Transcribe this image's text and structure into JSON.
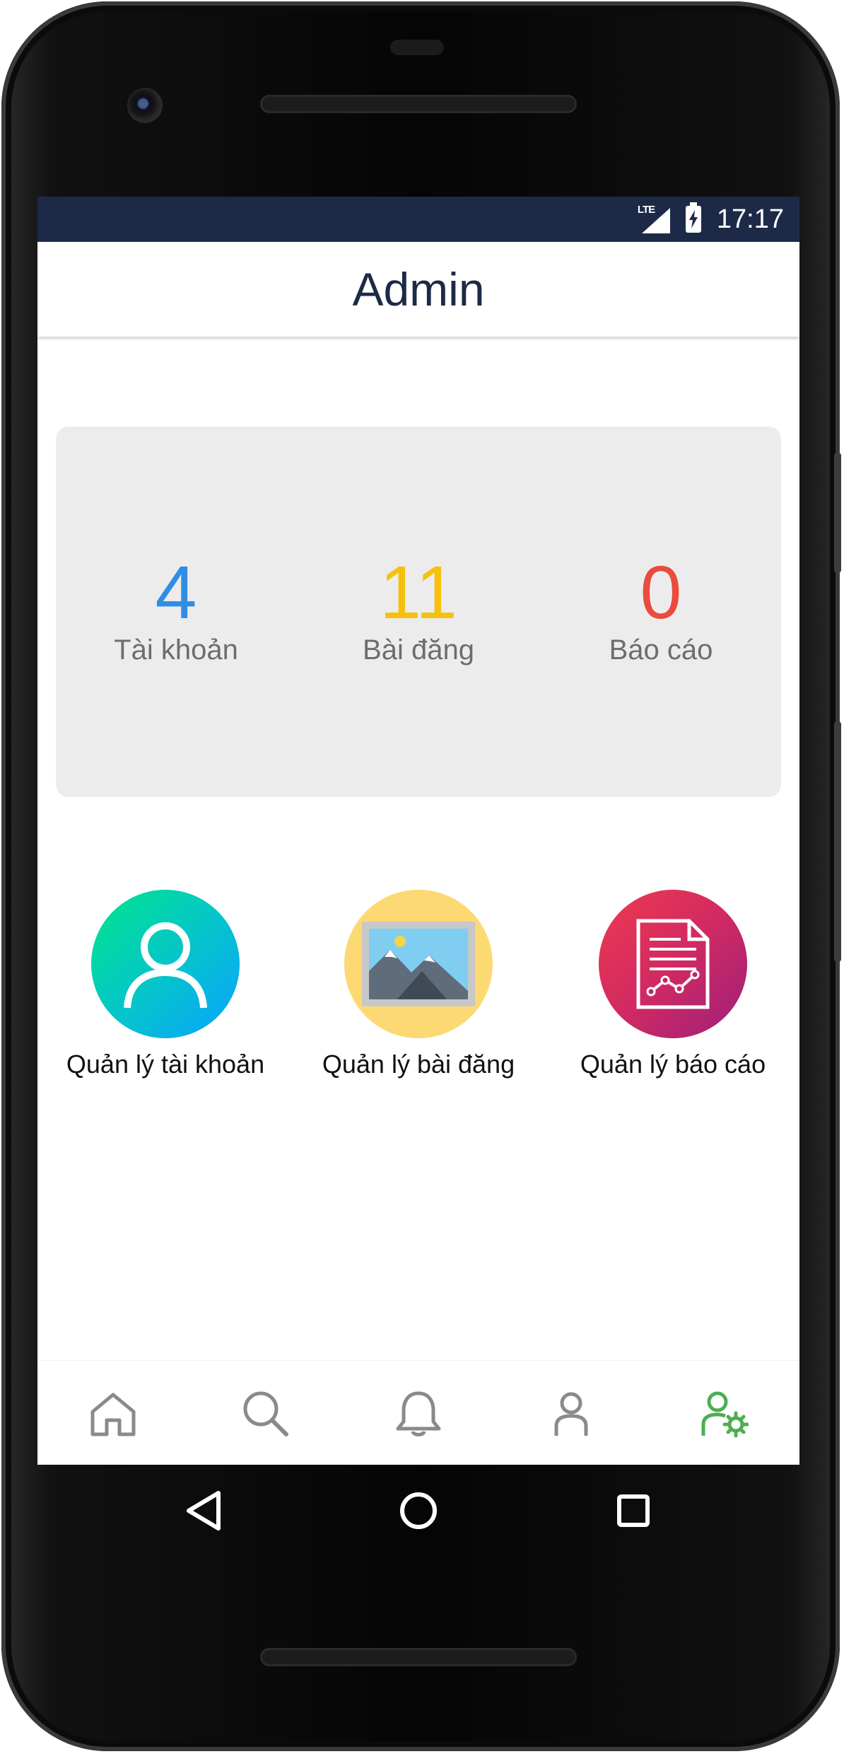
{
  "status_bar": {
    "network": "LTE",
    "time": "17:17"
  },
  "app_bar": {
    "title": "Admin"
  },
  "stats": [
    {
      "value": "4",
      "label": "Tài khoản",
      "color": "#2f8de4"
    },
    {
      "value": "11",
      "label": "Bài đăng",
      "color": "#f6c10d"
    },
    {
      "value": "0",
      "label": "Báo cáo",
      "color": "#e94b3c"
    }
  ],
  "actions": [
    {
      "label": "Quản lý tài khoản",
      "icon": "user-icon"
    },
    {
      "label": "Quản lý bài đăng",
      "icon": "image-icon"
    },
    {
      "label": "Quản lý báo cáo",
      "icon": "report-document-icon"
    }
  ],
  "bottom_nav": {
    "items": [
      "home-icon",
      "search-icon",
      "bell-icon",
      "profile-icon",
      "admin-settings-icon"
    ],
    "active": "admin-settings-icon",
    "active_color": "#4caf50",
    "inactive_color": "#8a8a8a"
  },
  "system_nav": [
    "back-icon",
    "home-circle-icon",
    "recents-icon"
  ]
}
